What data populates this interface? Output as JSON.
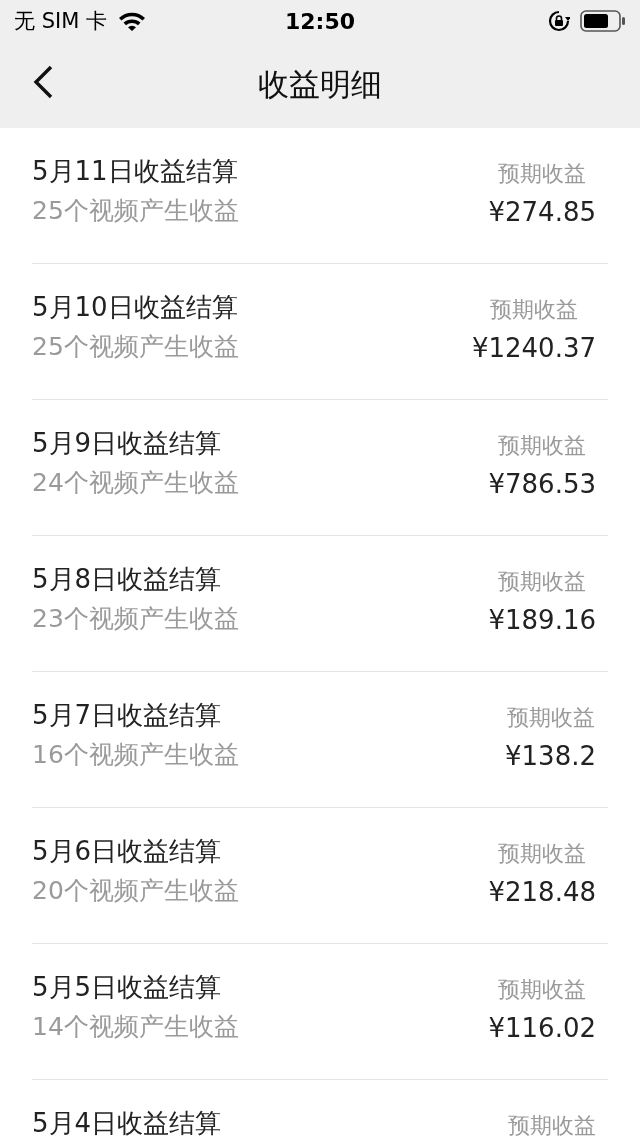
{
  "status_bar": {
    "carrier": "无 SIM 卡",
    "time": "12:50"
  },
  "nav": {
    "title": "收益明细"
  },
  "rows": [
    {
      "title": "5月11日收益结算",
      "subtitle": "25个视频产生收益",
      "label": "预期收益",
      "amount": "¥274.85"
    },
    {
      "title": "5月10日收益结算",
      "subtitle": "25个视频产生收益",
      "label": "预期收益",
      "amount": "¥1240.37"
    },
    {
      "title": "5月9日收益结算",
      "subtitle": "24个视频产生收益",
      "label": "预期收益",
      "amount": "¥786.53"
    },
    {
      "title": "5月8日收益结算",
      "subtitle": "23个视频产生收益",
      "label": "预期收益",
      "amount": "¥189.16"
    },
    {
      "title": "5月7日收益结算",
      "subtitle": "16个视频产生收益",
      "label": "预期收益",
      "amount": "¥138.2"
    },
    {
      "title": "5月6日收益结算",
      "subtitle": "20个视频产生收益",
      "label": "预期收益",
      "amount": "¥218.48"
    },
    {
      "title": "5月5日收益结算",
      "subtitle": "14个视频产生收益",
      "label": "预期收益",
      "amount": "¥116.02"
    },
    {
      "title": "5月4日收益结算",
      "label": "预期收益"
    }
  ]
}
